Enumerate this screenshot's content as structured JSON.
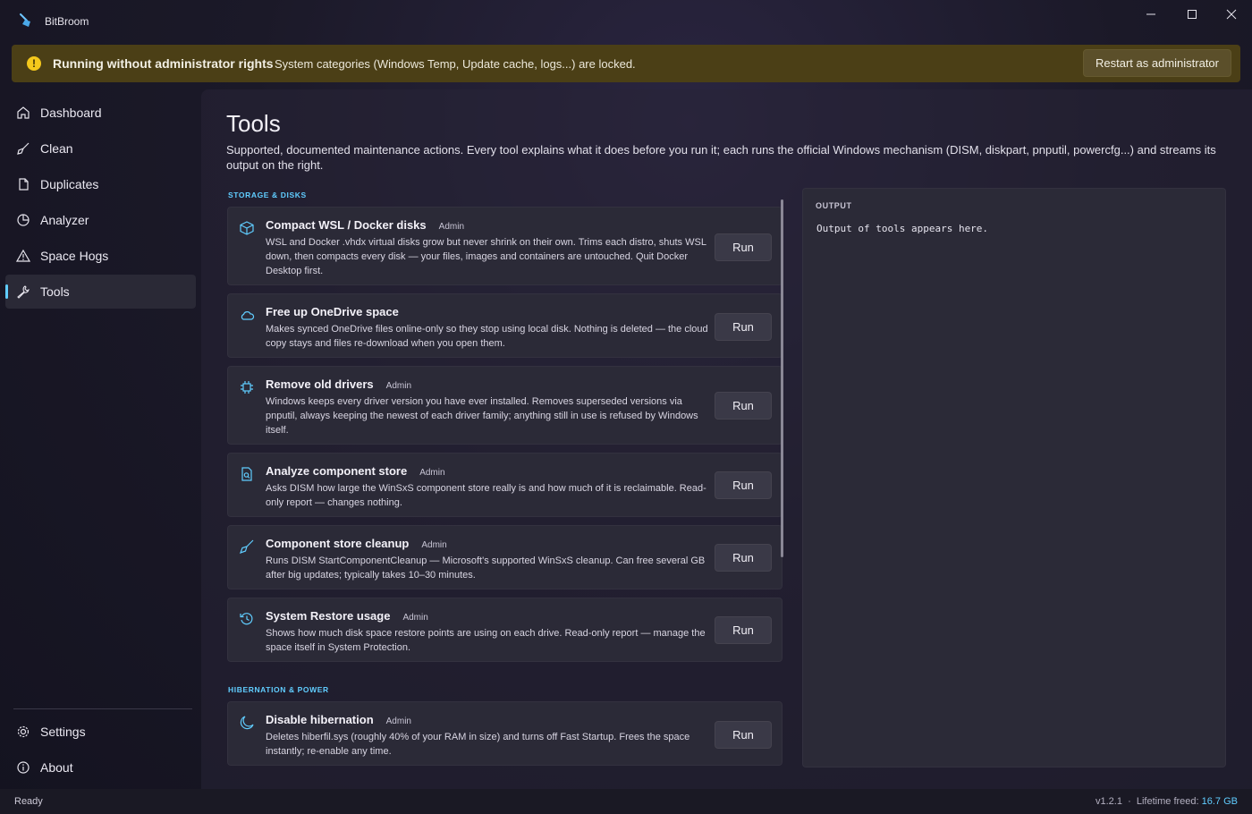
{
  "app": {
    "title": "BitBroom"
  },
  "banner": {
    "title": "Running without administrator rights",
    "message": "System categories (Windows Temp, Update cache, logs...) are locked.",
    "button": "Restart as administrator"
  },
  "sidebar": {
    "items": [
      {
        "label": "Dashboard",
        "icon": "home-icon"
      },
      {
        "label": "Clean",
        "icon": "broom-icon"
      },
      {
        "label": "Duplicates",
        "icon": "duplicate-icon"
      },
      {
        "label": "Analyzer",
        "icon": "pie-chart-icon"
      },
      {
        "label": "Space Hogs",
        "icon": "warning-icon"
      },
      {
        "label": "Tools",
        "icon": "wrench-icon",
        "active": true
      }
    ],
    "footer": [
      {
        "label": "Settings",
        "icon": "gear-icon"
      },
      {
        "label": "About",
        "icon": "info-icon"
      }
    ]
  },
  "page": {
    "title": "Tools",
    "description": "Supported, documented maintenance actions. Every tool explains what it does before you run it; each runs the official Windows mechanism (DISM, diskpart, pnputil, powercfg...) and streams its output on the right."
  },
  "sections": [
    {
      "title": "STORAGE & DISKS",
      "tools": [
        {
          "title": "Compact WSL / Docker disks",
          "badge": "Admin",
          "icon": "cube-icon",
          "description": "WSL and Docker .vhdx virtual disks grow but never shrink on their own. Trims each distro, shuts WSL down, then compacts every disk — your files, images and containers are untouched. Quit Docker Desktop first.",
          "button": "Run"
        },
        {
          "title": "Free up OneDrive space",
          "badge": "",
          "icon": "cloud-icon",
          "description": "Makes synced OneDrive files online-only so they stop using local disk. Nothing is deleted — the cloud copy stays and files re-download when you open them.",
          "button": "Run"
        },
        {
          "title": "Remove old drivers",
          "badge": "Admin",
          "icon": "chip-icon",
          "description": "Windows keeps every driver version you have ever installed. Removes superseded versions via pnputil, always keeping the newest of each driver family; anything still in use is refused by Windows itself.",
          "button": "Run"
        },
        {
          "title": "Analyze component store",
          "badge": "Admin",
          "icon": "document-search-icon",
          "description": "Asks DISM how large the WinSxS component store really is and how much of it is reclaimable. Read-only report — changes nothing.",
          "button": "Run"
        },
        {
          "title": "Component store cleanup",
          "badge": "Admin",
          "icon": "broom-icon",
          "description": "Runs DISM StartComponentCleanup — Microsoft's supported WinSxS cleanup. Can free several GB after big updates; typically takes 10–30 minutes.",
          "button": "Run"
        },
        {
          "title": "System Restore usage",
          "badge": "Admin",
          "icon": "history-icon",
          "description": "Shows how much disk space restore points are using on each drive. Read-only report — manage the space itself in System Protection.",
          "button": "Run"
        }
      ]
    },
    {
      "title": "HIBERNATION & POWER",
      "tools": [
        {
          "title": "Disable hibernation",
          "badge": "Admin",
          "icon": "moon-icon",
          "description": "Deletes hiberfil.sys (roughly 40% of your RAM in size) and turns off Fast Startup. Frees the space instantly; re-enable any time.",
          "button": "Run"
        }
      ]
    }
  ],
  "output": {
    "title": "OUTPUT",
    "text": "Output of tools appears here."
  },
  "status": {
    "left": "Ready",
    "version": "v1.2.1",
    "separator": "·",
    "freed_label": "Lifetime freed:",
    "freed_value": "16.7 GB"
  },
  "colors": {
    "accent": "#60cdff",
    "banner": "#4b3f16",
    "warning": "#f4c81c"
  }
}
